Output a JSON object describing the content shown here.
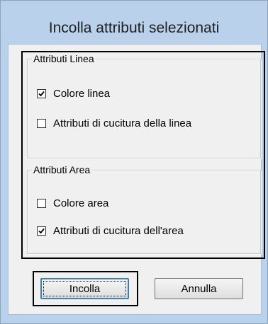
{
  "dialog": {
    "title": "Incolla attributi selezionati"
  },
  "line_group": {
    "legend": "Attributi Linea",
    "options": [
      {
        "label": "Colore linea",
        "checked": true
      },
      {
        "label": "Attributi di cucitura della linea",
        "checked": false
      }
    ]
  },
  "area_group": {
    "legend": "Attributi Area",
    "options": [
      {
        "label": "Colore area",
        "checked": false
      },
      {
        "label": "Attributi di cucitura dell'area",
        "checked": true
      }
    ]
  },
  "buttons": {
    "ok_label": "Incolla",
    "cancel_label": "Annulla"
  },
  "colors": {
    "frame": "#b9d1ea",
    "client": "#f0f0f0",
    "default_button_border": "#3c7fb1"
  }
}
